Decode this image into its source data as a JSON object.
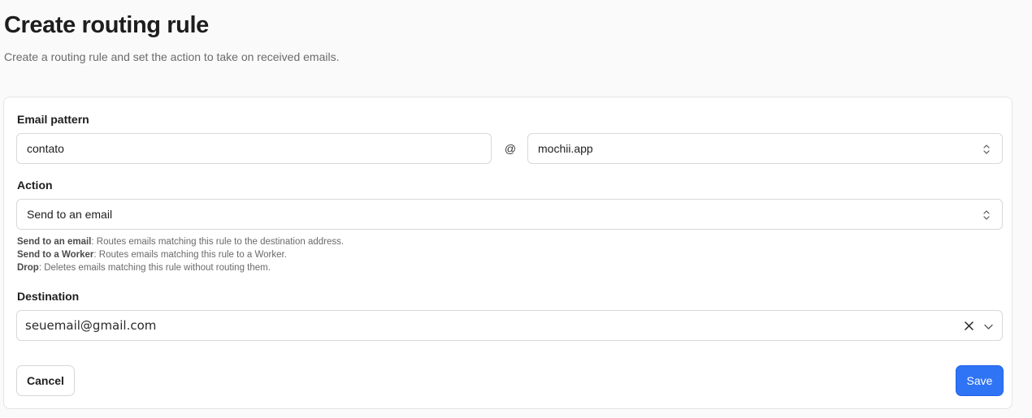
{
  "header": {
    "title": "Create routing rule",
    "subtitle": "Create a routing rule and set the action to take on received emails."
  },
  "form": {
    "email_pattern": {
      "label": "Email pattern",
      "local_part_value": "contato",
      "at_sign": "@",
      "domain_value": "mochii.app"
    },
    "action": {
      "label": "Action",
      "selected": "Send to an email",
      "help": [
        {
          "term": "Send to an email",
          "desc": ": Routes emails matching this rule to the destination address."
        },
        {
          "term": "Send to a Worker",
          "desc": ": Routes emails matching this rule to a Worker."
        },
        {
          "term": "Drop",
          "desc": ": Deletes emails matching this rule without routing them."
        }
      ]
    },
    "destination": {
      "label": "Destination",
      "value": "seuemail@gmail.com"
    }
  },
  "buttons": {
    "cancel_label": "Cancel",
    "save_label": "Save"
  },
  "colors": {
    "primary": "#2f74f5",
    "background": "#fafafa",
    "card": "#ffffff",
    "border": "#e4e4e4"
  },
  "icons": {
    "domain_select": "updown-chevron-icon",
    "action_select": "updown-chevron-icon",
    "clear": "close-icon",
    "dropdown": "chevron-down-icon"
  }
}
